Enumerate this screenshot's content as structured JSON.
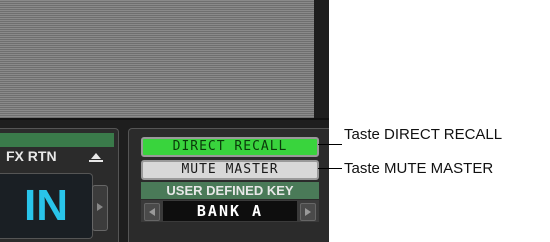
{
  "fx_return": {
    "label": "FX RTN",
    "value": "IN"
  },
  "keys": {
    "direct_recall": "DIRECT RECALL",
    "mute_master": "MUTE MASTER"
  },
  "user_defined_key": {
    "header": "USER DEFINED KEY",
    "bank": "BANK A"
  },
  "callouts": {
    "direct_recall": "Taste DIRECT RECALL",
    "mute_master": "Taste MUTE MASTER"
  },
  "colors": {
    "direct_recall_bg": "#39d43d",
    "in_text": "#29c4ea",
    "panel_header_green": "#3a7a4a"
  }
}
